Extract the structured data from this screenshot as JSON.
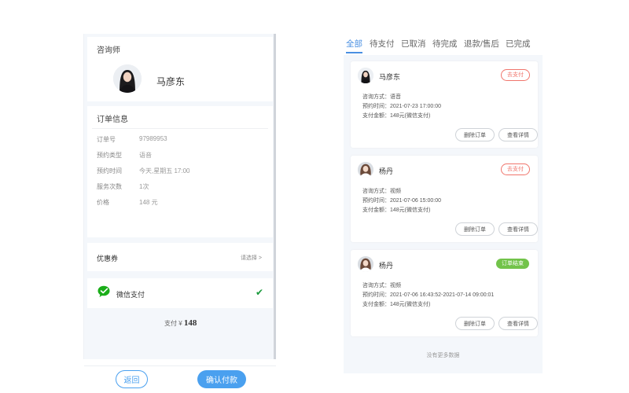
{
  "checkout": {
    "counselor_section_title": "咨询师",
    "counselor_name": "马彦东",
    "order_section_title": "订单信息",
    "order_rows": [
      {
        "label": "订单号",
        "value": "97989953"
      },
      {
        "label": "预约类型",
        "value": "语音"
      },
      {
        "label": "预约时间",
        "value": "今天,星期五 17:00"
      },
      {
        "label": "服务次数",
        "value": "1次"
      },
      {
        "label": "价格",
        "value": "148 元"
      }
    ],
    "coupon_label": "优惠券",
    "coupon_select": "请选择 >",
    "payment_method": "微信支付",
    "total_label": "支付 ¥",
    "total_amount": "148",
    "back_button": "返回",
    "confirm_button": "确认付款"
  },
  "orders": {
    "tabs": [
      "全部",
      "待支付",
      "已取消",
      "待完成",
      "退款/售后",
      "已完成"
    ],
    "active_tab": 0,
    "items": [
      {
        "name": "马彦东",
        "status": "去支付",
        "status_type": "pay",
        "method_line": "咨询方式：语音",
        "time_line": "预约时间：2021-07-23 17:00:00",
        "amount_line": "支付金额：148元(微信支付)",
        "delete_button": "删除订单",
        "detail_button": "查看详情"
      },
      {
        "name": "杨丹",
        "status": "去支付",
        "status_type": "pay",
        "method_line": "咨询方式：视频",
        "time_line": "预约时间：2021-07-06 15:00:00",
        "amount_line": "支付金额：148元(微信支付)",
        "delete_button": "删除订单",
        "detail_button": "查看详情"
      },
      {
        "name": "杨丹",
        "status": "订单结束",
        "status_type": "done",
        "method_line": "咨询方式：视频",
        "time_line": "预约时间：2021-07-06 16:43:52-2021-07-14 09:00:01",
        "amount_line": "支付金额：148元(微信支付)",
        "delete_button": "删除订单",
        "detail_button": "查看详情"
      }
    ],
    "no_more_text": "没有更多数据"
  },
  "colors": {
    "accent_blue": "#4aa0ef",
    "pay_red": "#f0756c",
    "done_green": "#72c34a",
    "wechat_green": "#1aad19"
  }
}
